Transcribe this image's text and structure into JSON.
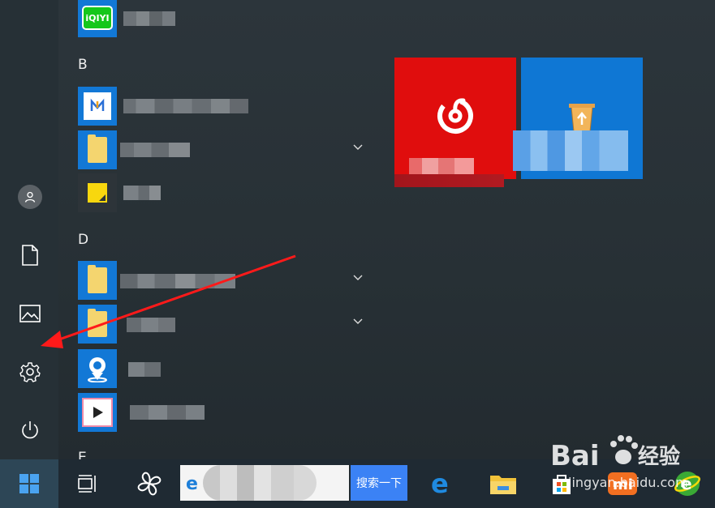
{
  "sections": {
    "b": "B",
    "d": "D",
    "e": "E"
  },
  "taskbar": {
    "search_button_label": "搜索一下"
  },
  "watermark": {
    "brand_main": "Bai",
    "brand_tail": "经验",
    "url": "jingyan.baidu.com"
  },
  "colors": {
    "accent_red": "#e00d0d",
    "accent_blue": "#0f77d4",
    "app_tile_blue": "#1278d6",
    "search_button": "#3b82f5",
    "annotation_arrow": "#ff1a1a"
  },
  "icons": {
    "rail": [
      "user-icon",
      "document-icon",
      "pictures-icon",
      "settings-gear-icon",
      "power-icon"
    ],
    "taskbar": [
      "windows-logo-icon",
      "task-view-icon",
      "pinwheel-app-icon",
      "ie-icon",
      "edge-icon",
      "file-explorer-icon",
      "store-icon",
      "mi-icon",
      "360-browser-icon"
    ]
  }
}
